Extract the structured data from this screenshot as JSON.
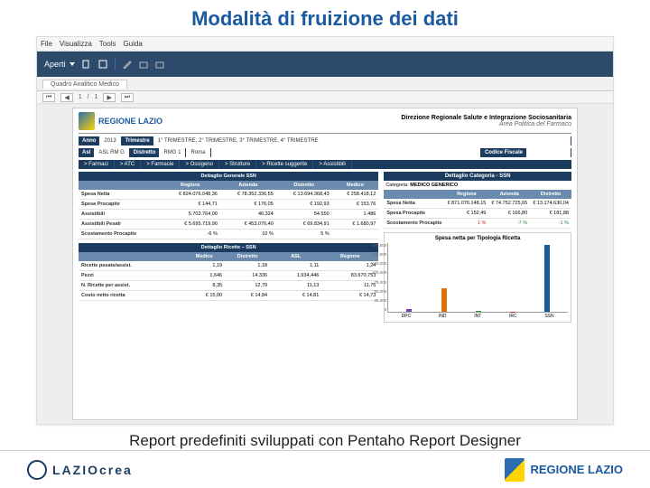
{
  "title": "Modalità di fruizione dei dati",
  "caption": "Report predefiniti sviluppati con Pentaho Report Designer",
  "menubar": {
    "items": [
      "File",
      "Visualizza",
      "Tools",
      "Guida"
    ]
  },
  "toolbar": {
    "open": "Aperti"
  },
  "tab": {
    "label": "Quadro Analitico Medico"
  },
  "pager": {
    "page": "1",
    "sep": "/",
    "total": "1"
  },
  "report_header": {
    "logo_text": "REGIONE LAZIO",
    "line1": "Direzione Regionale Salute e Integrazione Sociosanitaria",
    "line2": "Area Politica del Farmaco"
  },
  "filters": {
    "anno_label": "Anno",
    "anno_val": "2013",
    "trim_label": "Trimestre",
    "trim_val": "1° TRIMESTRE, 2° TRIMESTRE, 3° TRIMESTRE, 4° TRIMESTRE",
    "asl_label": "Asl",
    "asl_val": "ASL RM G",
    "dist_label": "Distretto",
    "dist_val": "RMG 1",
    "com_val": "Roma",
    "cod_label": "Codice Fiscale"
  },
  "navpills": [
    "> Farmaci",
    "> ATC",
    "> Farmacie",
    "> Ossigeno",
    "> Strutture",
    "> Ricette suggerite",
    "> Assistibili"
  ],
  "tableA": {
    "title": "Dettaglio Generale SSN",
    "cols": [
      "",
      "Regione",
      "Azienda",
      "Distretto",
      "Medico"
    ],
    "rows": [
      [
        "Spesa Netta",
        "€ 824.076.048,36",
        "€ 78.352.336,55",
        "€ 13.694.368,43",
        "€ 258.418,12"
      ],
      [
        "Spesa Procapite",
        "€ 144,71",
        "€ 176,05",
        "€ 192,93",
        "€ 153,76"
      ],
      [
        "Assistibili",
        "5.702.764,00",
        "46.324",
        "54.550",
        "1.486"
      ],
      [
        "Assistibili Pesati",
        "€ 5.695.719,90",
        "€ 453.076,40",
        "€ 69.834,91",
        "€ 1.680,97"
      ],
      "_scost",
      [
        "Scostamento Procapite",
        "-6 %",
        "10 %",
        "5 %",
        ""
      ]
    ]
  },
  "tableB": {
    "title": "Dettaglio Categoria - SSN",
    "cat_label": "Categoria:",
    "cat_val": "MEDICO GENERICO",
    "cols": [
      "",
      "Regione",
      "Azienda",
      "Distretto"
    ],
    "rows": [
      [
        "Spesa Netta",
        "€ 871.076.148,15",
        "€ 74.752.725,65",
        "€ 13.174.630,04"
      ],
      [
        "Spesa Procapite",
        "€ 152,49",
        "€ 166,80",
        "€ 181,88"
      ],
      "_scost",
      [
        "Scostamento Procapite",
        "1 %",
        "-7 %",
        "-1 %"
      ]
    ]
  },
  "tableC": {
    "title": "Dettaglio Ricette – SSN",
    "cols": [
      "",
      "Medico",
      "Distretto",
      "ASL",
      "Regione"
    ],
    "rows": [
      [
        "Ricette pesate/assist.",
        "1,19",
        "1,18",
        "1,11",
        "1,24"
      ],
      [
        "Pezzi",
        "1,646",
        "14.336",
        "1,934,446",
        "83.670,753"
      ],
      [
        "N. Ricette per assist.",
        "8,35",
        "12,79",
        "11,13",
        "11,75"
      ],
      [
        "Costo netto ricetta",
        "€ 15,00",
        "€ 14,84",
        "€ 14,81",
        "€ 14,73"
      ]
    ]
  },
  "chart_data": {
    "type": "bar",
    "title": "Spesa netta per Tipologia Ricetta",
    "categories": [
      "DPC",
      "IND",
      "INT",
      "IRC",
      "SSN"
    ],
    "values": [
      8000,
      60000,
      3000,
      500,
      170000
    ],
    "colors": [
      "#7b3fb5",
      "#e07000",
      "#2e8b2e",
      "#c62828",
      "#1a5aa0"
    ],
    "ylim": [
      0,
      175000
    ],
    "yticks": [
      "175,000",
      "150,000",
      "125,000",
      "100,000",
      "75,000",
      "50,000",
      "25,000",
      "0"
    ]
  },
  "footer": {
    "left": "LAZIOcrea",
    "right": "REGIONE LAZIO"
  }
}
